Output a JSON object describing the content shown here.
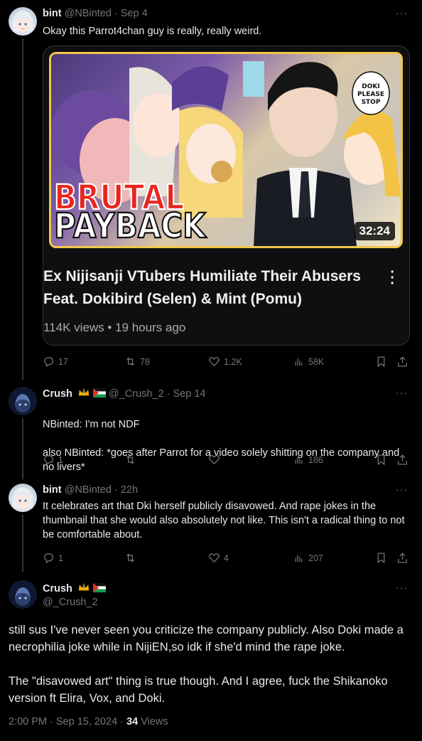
{
  "tweet1": {
    "name": "bint",
    "handle": "@NBinted",
    "time": "Sep 4",
    "text": "Okay this Parrot4chan guy is really, really weird.",
    "video": {
      "thumb_line1": "BRUTAL",
      "thumb_line2": "PAYBACK",
      "doki_bubble": "DOKI PLEASE STOP",
      "duration": "32:24",
      "title": "Ex Nijisanji VTubers Humiliate Their Abusers Feat. Dokibird (Selen) & Mint (Pomu)",
      "meta": "114K views • 19 hours ago"
    },
    "replies": "17",
    "retweets": "78",
    "likes": "1.2K",
    "views": "58K"
  },
  "tweet2": {
    "name": "Crush",
    "handle": "@_Crush_2",
    "time": "Sep 14",
    "line1": "NBinted: I'm not NDF",
    "line2": "also NBinted: *goes after Parrot for a video solely shitting on the company and no livers*",
    "replies": "1",
    "retweets": "",
    "likes": "",
    "views": "186"
  },
  "tweet3": {
    "name": "bint",
    "handle": "@NBinted",
    "time": "22h",
    "text": "It celebrates art that Dki herself publicly disavowed. And rape jokes in the thumbnail that she would also absolutely not like. This isn't a radical thing to not be comfortable about.",
    "replies": "1",
    "retweets": "",
    "likes": "4",
    "views": "207"
  },
  "tweet4": {
    "name": "Crush",
    "handle": "@_Crush_2",
    "para1": "still sus I've never seen you criticize the company publicly. Also Doki made a necrophilia joke while in NijiEN,so idk if she'd mind the rape joke.",
    "para2": "The \"disavowed art\" thing is true though. And I agree, fuck the Shikanoko version ft Elira, Vox, and Doki.",
    "timestamp": "2:00 PM · Sep 15, 2024 · ",
    "view_count": "34",
    "views_label": "Views"
  },
  "icons": {
    "more": "more-dots-icon",
    "reply": "reply-icon",
    "retweet": "retweet-icon",
    "like": "heart-icon",
    "views": "views-chart-icon",
    "bookmark": "bookmark-icon",
    "share": "share-icon"
  },
  "colors": {
    "background": "#000000",
    "text": "#e7e9ea",
    "muted": "#71767b",
    "divider": "#2f3336"
  }
}
